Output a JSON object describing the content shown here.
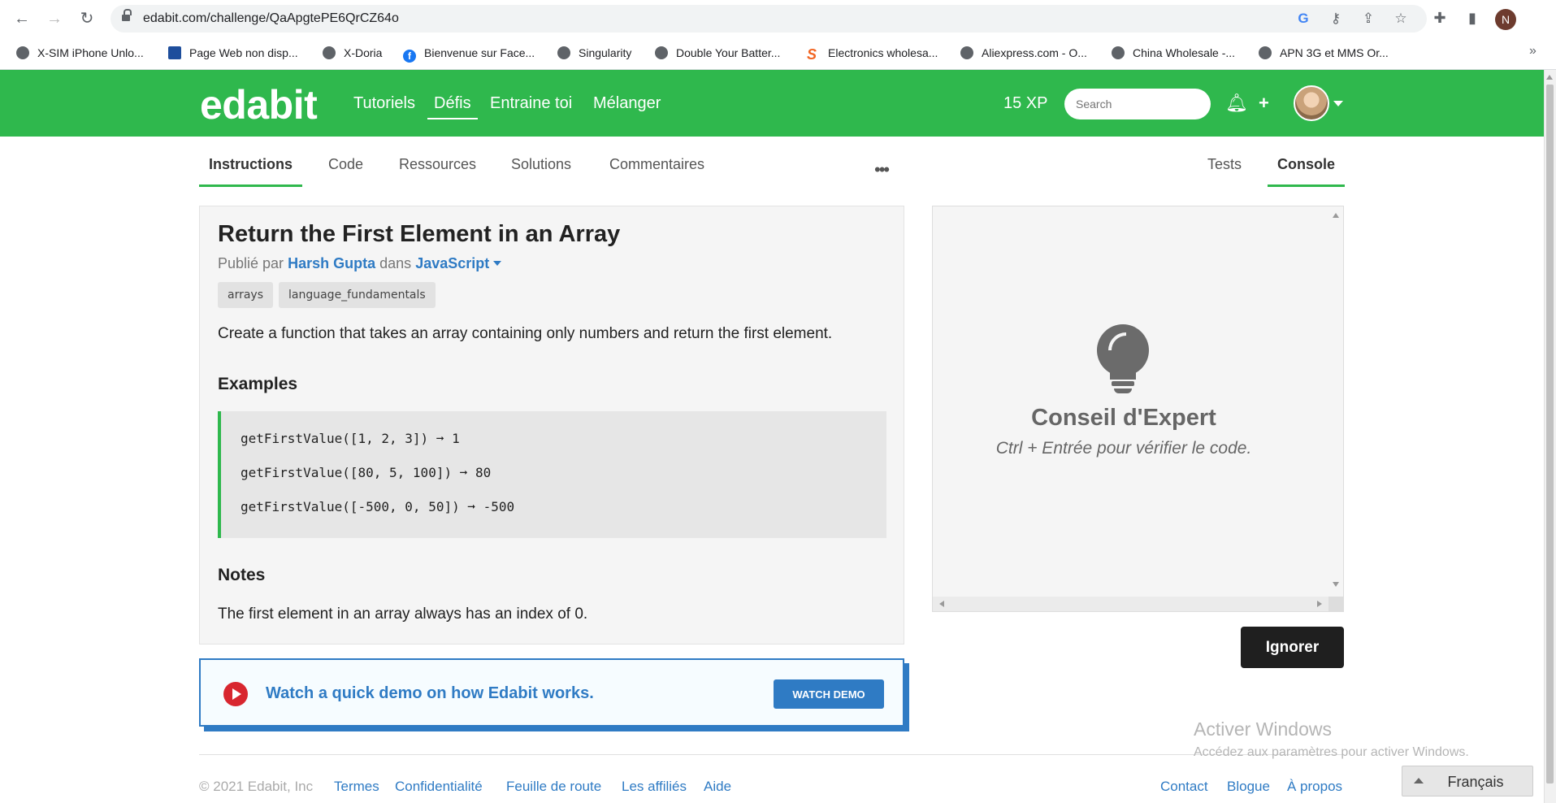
{
  "browser": {
    "url": "edabit.com/challenge/QaApgtePE6QrCZ64o",
    "profile_initial": "N",
    "bookmarks": [
      {
        "label": "X-SIM iPhone Unlo...",
        "icon": "globe-icon"
      },
      {
        "label": "Page Web non disp...",
        "icon": "site-icon"
      },
      {
        "label": "X-Doria",
        "icon": "globe-icon"
      },
      {
        "label": "Bienvenue sur Face...",
        "icon": "facebook-icon"
      },
      {
        "label": "Singularity",
        "icon": "globe-icon"
      },
      {
        "label": "Double Your Batter...",
        "icon": "globe-icon"
      },
      {
        "label": "Electronics wholesa...",
        "icon": "s-logo-icon"
      },
      {
        "label": "Aliexpress.com - O...",
        "icon": "globe-icon"
      },
      {
        "label": "China Wholesale -...",
        "icon": "globe-icon"
      },
      {
        "label": "APN 3G et MMS Or...",
        "icon": "globe-icon"
      }
    ],
    "bookmarks_more": "»"
  },
  "header": {
    "logo": "edabit",
    "nav": [
      "Tutoriels",
      "Défis",
      "Entraine toi",
      "Mélanger"
    ],
    "active_nav": "Défis",
    "xp": "15 XP",
    "search_placeholder": "Search"
  },
  "tabs": {
    "left": [
      "Instructions",
      "Code",
      "Ressources",
      "Solutions",
      "Commentaires"
    ],
    "right": [
      "Tests",
      "Console"
    ],
    "more": "•••"
  },
  "challenge": {
    "title": "Return the First Element in an Array",
    "published_by": "Publié par",
    "author": "Harsh Gupta",
    "in_word": "dans",
    "language": "JavaScript",
    "tags": [
      "arrays",
      "language_fundamentals"
    ],
    "description": "Create a function that takes an array containing only numbers and return the first element.",
    "examples_heading": "Examples",
    "examples": [
      "getFirstValue([1, 2, 3]) ➞ 1",
      "getFirstValue([80, 5, 100]) ➞ 80",
      "getFirstValue([-500, 0, 50]) ➞ -500"
    ],
    "notes_heading": "Notes",
    "notes": "The first element in an array always has an index of 0."
  },
  "demo": {
    "text": "Watch a quick demo on how Edabit works.",
    "button": "WATCH DEMO"
  },
  "console": {
    "tip_title": "Conseil d'Expert",
    "tip_sub": "Ctrl + Entrée pour vérifier le code.",
    "ignore_button": "Ignorer"
  },
  "footer": {
    "copyright": "© 2021 Edabit, Inc",
    "left_links": [
      "Termes",
      "Confidentialité",
      "Feuille de route",
      "Les affiliés",
      "Aide"
    ],
    "right_links": [
      "Contact",
      "Blogue",
      "À propos"
    ]
  },
  "windows_watermark": {
    "title": "Activer Windows",
    "subtitle": "Accédez aux paramètres pour activer Windows."
  },
  "language_selector": "Français",
  "colors": {
    "brand_green": "#2fb84d",
    "link_blue": "#2f7bc4",
    "demo_red": "#d8262f"
  }
}
